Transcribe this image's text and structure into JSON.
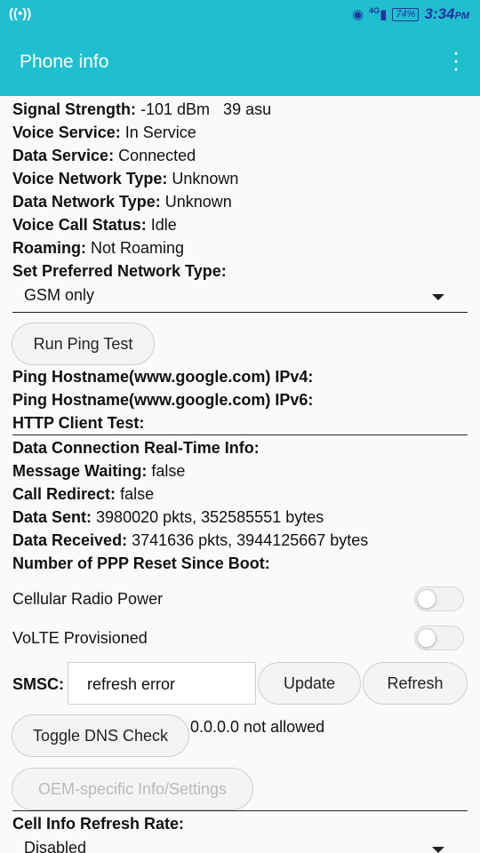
{
  "status_bar": {
    "left_icon": "((•))",
    "network": "4G",
    "battery": "74%",
    "time": "3:34",
    "ampm": "PM"
  },
  "app_bar": {
    "title": "Phone info"
  },
  "info": {
    "signal_label": "Signal Strength:",
    "signal_value": "-101 dBm   39 asu",
    "voice_service_label": "Voice Service:",
    "voice_service_value": "In Service",
    "data_service_label": "Data Service:",
    "data_service_value": "Connected",
    "voice_net_label": "Voice Network Type:",
    "voice_net_value": "Unknown",
    "data_net_label": "Data Network Type:",
    "data_net_value": "Unknown",
    "voice_call_label": "Voice Call Status:",
    "voice_call_value": "Idle",
    "roaming_label": "Roaming:",
    "roaming_value": "Not Roaming",
    "pref_net_label": "Set Preferred Network Type:",
    "pref_net_selected": "GSM only"
  },
  "ping": {
    "button": "Run Ping Test",
    "ipv4_label": "Ping Hostname(www.google.com) IPv4:",
    "ipv6_label": "Ping Hostname(www.google.com) IPv6:",
    "http_label": "HTTP Client Test:"
  },
  "realtime": {
    "header": "Data Connection Real-Time Info:",
    "msg_wait_label": "Message Waiting:",
    "msg_wait_value": "false",
    "call_redirect_label": "Call Redirect:",
    "call_redirect_value": "false",
    "data_sent_label": "Data Sent:",
    "data_sent_value": "3980020 pkts, 352585551 bytes",
    "data_recv_label": "Data Received:",
    "data_recv_value": "3741636 pkts, 3944125667 bytes",
    "ppp_label": "Number of PPP Reset Since Boot:"
  },
  "toggles": {
    "radio_power": "Cellular Radio Power",
    "volte": "VoLTE Provisioned"
  },
  "smsc": {
    "label": "SMSC:",
    "value": "refresh error",
    "update": "Update",
    "refresh": "Refresh"
  },
  "dns": {
    "button": "Toggle DNS Check",
    "status": "0.0.0.0 not allowed"
  },
  "oem": {
    "button": "OEM-specific Info/Settings"
  },
  "cell_info": {
    "label": "Cell Info Refresh Rate:",
    "selected": "Disabled"
  }
}
